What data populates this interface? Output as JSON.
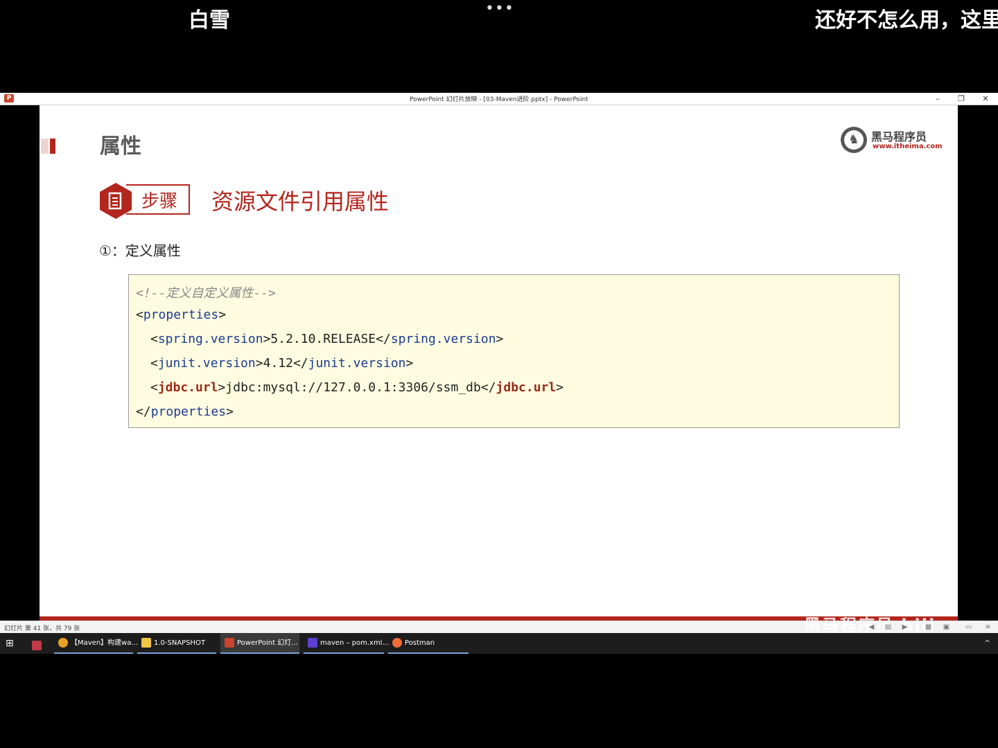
{
  "overlay": {
    "danmu_left": "白雪",
    "danmu_right": "还好不怎么用，这里",
    "more_dots": "•••"
  },
  "window": {
    "title": "PowerPoint 幻灯片放映 - [03-Maven进阶.pptx] - PowerPoint",
    "minimize": "–",
    "maximize": "❐",
    "close": "✕"
  },
  "slide": {
    "title": "属性",
    "logo_name": "黑马程序员",
    "logo_url": "www.itheima.com",
    "step_label": "步骤",
    "step_heading": "资源文件引用属性",
    "step_item": "①：定义属性",
    "code": {
      "comment": "<!--定义自定义属性-->",
      "open_tag": "properties",
      "props": [
        {
          "name": "spring.version",
          "value": "5.2.10.RELEASE",
          "bold": false
        },
        {
          "name": "junit.version",
          "value": "4.12",
          "bold": false
        },
        {
          "name": "jdbc.url",
          "value": "jdbc:mysql://127.0.0.1:3306/ssm_db",
          "bold": true
        }
      ],
      "close_tag": "properties"
    }
  },
  "status_bar": {
    "text": "幻灯片 第 41 张，共 79 张",
    "watermark": "黑马程序员 bili"
  },
  "taskbar": {
    "items": [
      {
        "label": "【Maven】构建wa...",
        "color": "#e6a023"
      },
      {
        "label": "1.0-SNAPSHOT",
        "color": "#f2c744"
      },
      {
        "label": "PowerPoint 幻灯...",
        "color": "#c9452b"
      },
      {
        "label": "maven – pom.xml...",
        "color": "#5b3fd1"
      },
      {
        "label": "Postman",
        "color": "#f26b3a"
      }
    ],
    "tray_up": "^"
  },
  "colors": {
    "accent": "#b3261e",
    "code_bg": "#fdfce0",
    "tag_blue": "#1d3b8f"
  }
}
